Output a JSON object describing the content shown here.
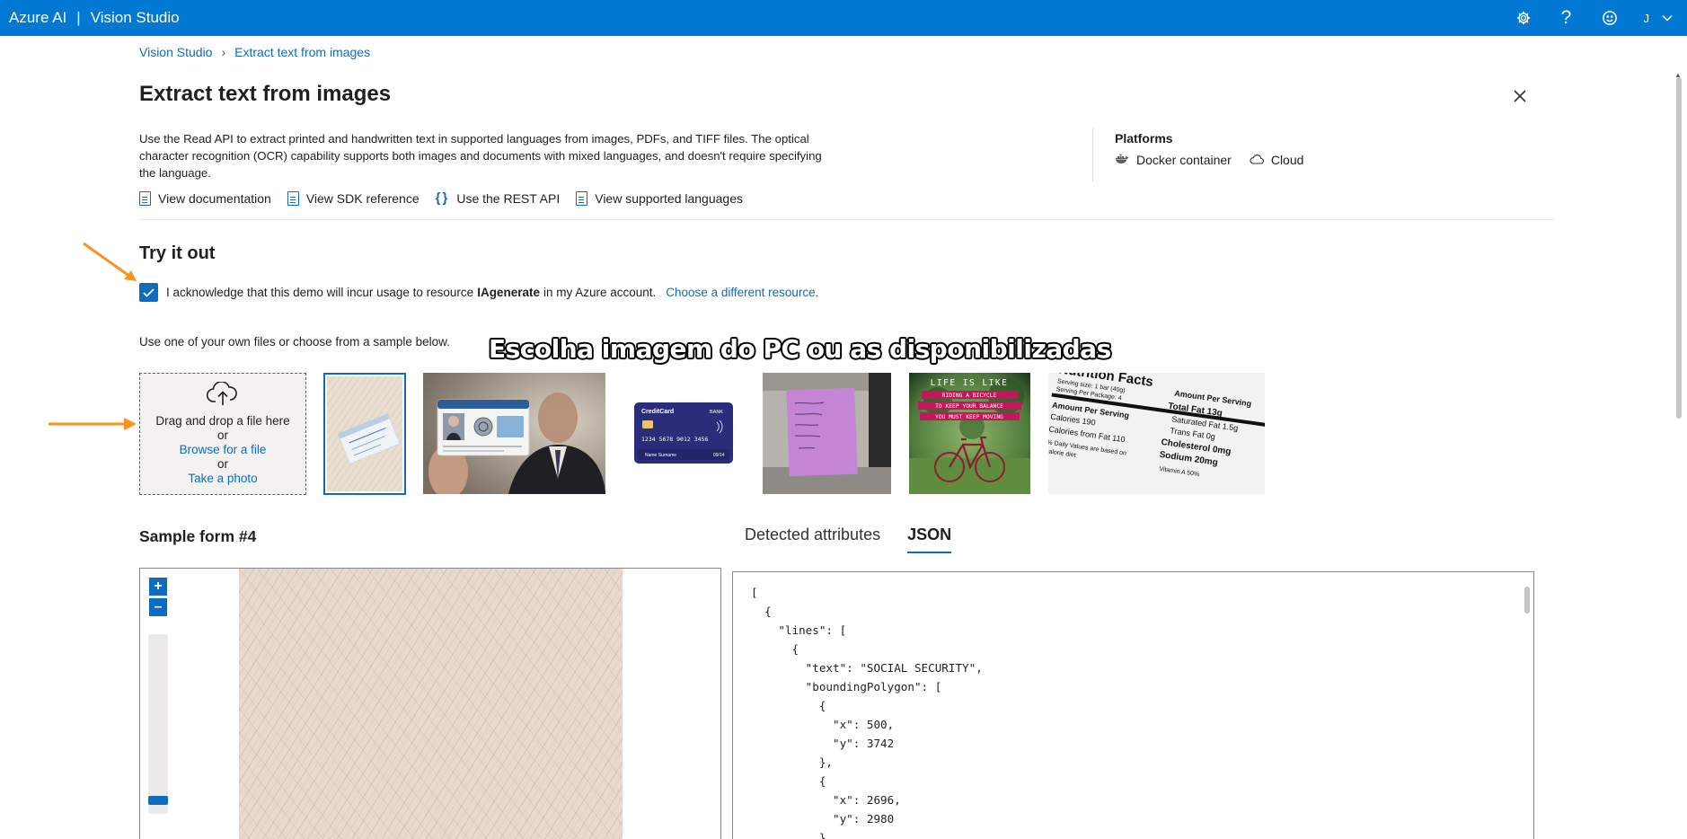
{
  "app": {
    "brand": "Azure AI",
    "separator": "|",
    "product": "Vision Studio",
    "accent": "#0078d4"
  },
  "topbar": {
    "settings_icon": "gear-icon",
    "help_icon": "question-icon",
    "feedback_icon": "smiley-icon",
    "user_initial": "J",
    "user_chevron": "chevron-down-icon"
  },
  "breadcrumb": {
    "root": "Vision Studio",
    "current": "Extract text from images"
  },
  "page": {
    "title": "Extract text from images",
    "description": "Use the Read API to extract printed and handwritten text in supported languages from images, PDFs, and TIFF files. The optical character recognition (OCR) capability supports both images and documents with mixed languages, and doesn't require specifying the language."
  },
  "platforms": {
    "title": "Platforms",
    "items": [
      "Docker container",
      "Cloud"
    ]
  },
  "links": [
    "View documentation",
    "View SDK reference",
    "Use the REST API",
    "View supported languages"
  ],
  "try_it_out": {
    "title": "Try it out",
    "ack_prefix": "I acknowledge that this demo will incur usage to resource",
    "resource_name": "IAgenerate",
    "ack_suffix": "in my Azure account.",
    "choose_resource": "Choose a different resource.",
    "use_text": "Use one of your own files or choose from a sample below.",
    "overlay_caption": "Escolha imagem do PC ou as disponibilizadas"
  },
  "dropzone": {
    "line1": "Drag and drop a file here",
    "or1": "or",
    "browse": "Browse for a file",
    "or2": "or",
    "photo": "Take a photo"
  },
  "samples": {
    "id_card_name": "Name Surname",
    "credit_card_label": "CreditCard",
    "credit_card_bank": "BANK",
    "credit_card_number": "1234 5678 9012 3456",
    "credit_card_expiry": "09/14",
    "poster_lines": [
      "LIFE IS LIKE",
      "RIDING A BICYCLE",
      "TO KEEP YOUR BALANCE",
      "YOU MUST KEEP MOVING"
    ],
    "nutrition": {
      "title": "Nutrition Facts",
      "serving": "Serving size: 1 bar (40g)",
      "per_package": "Serving Per Package: 4",
      "amount": "Amount Per Serving",
      "lines": [
        "Calories 190",
        "Calories from Fat 110",
        "Total Fat 13g",
        "Saturated Fat 1.5g",
        "Trans Fat 0g",
        "Cholesterol 0mg",
        "Sodium 20mg",
        "% Daily Values are based on",
        "calorie diet",
        "Vitamin A 50%"
      ]
    }
  },
  "result": {
    "sample_title": "Sample form #4",
    "tabs": [
      "Detected attributes",
      "JSON"
    ],
    "active_tab": "JSON",
    "zoom_in": "+",
    "zoom_out": "–",
    "json_text": "[\n  {\n    \"lines\": [\n      {\n        \"text\": \"SOCIAL SECURITY\",\n        \"boundingPolygon\": [\n          {\n            \"x\": 500,\n            \"y\": 3742\n          },\n          {\n            \"x\": 2696,\n            \"y\": 2980\n          },"
  }
}
